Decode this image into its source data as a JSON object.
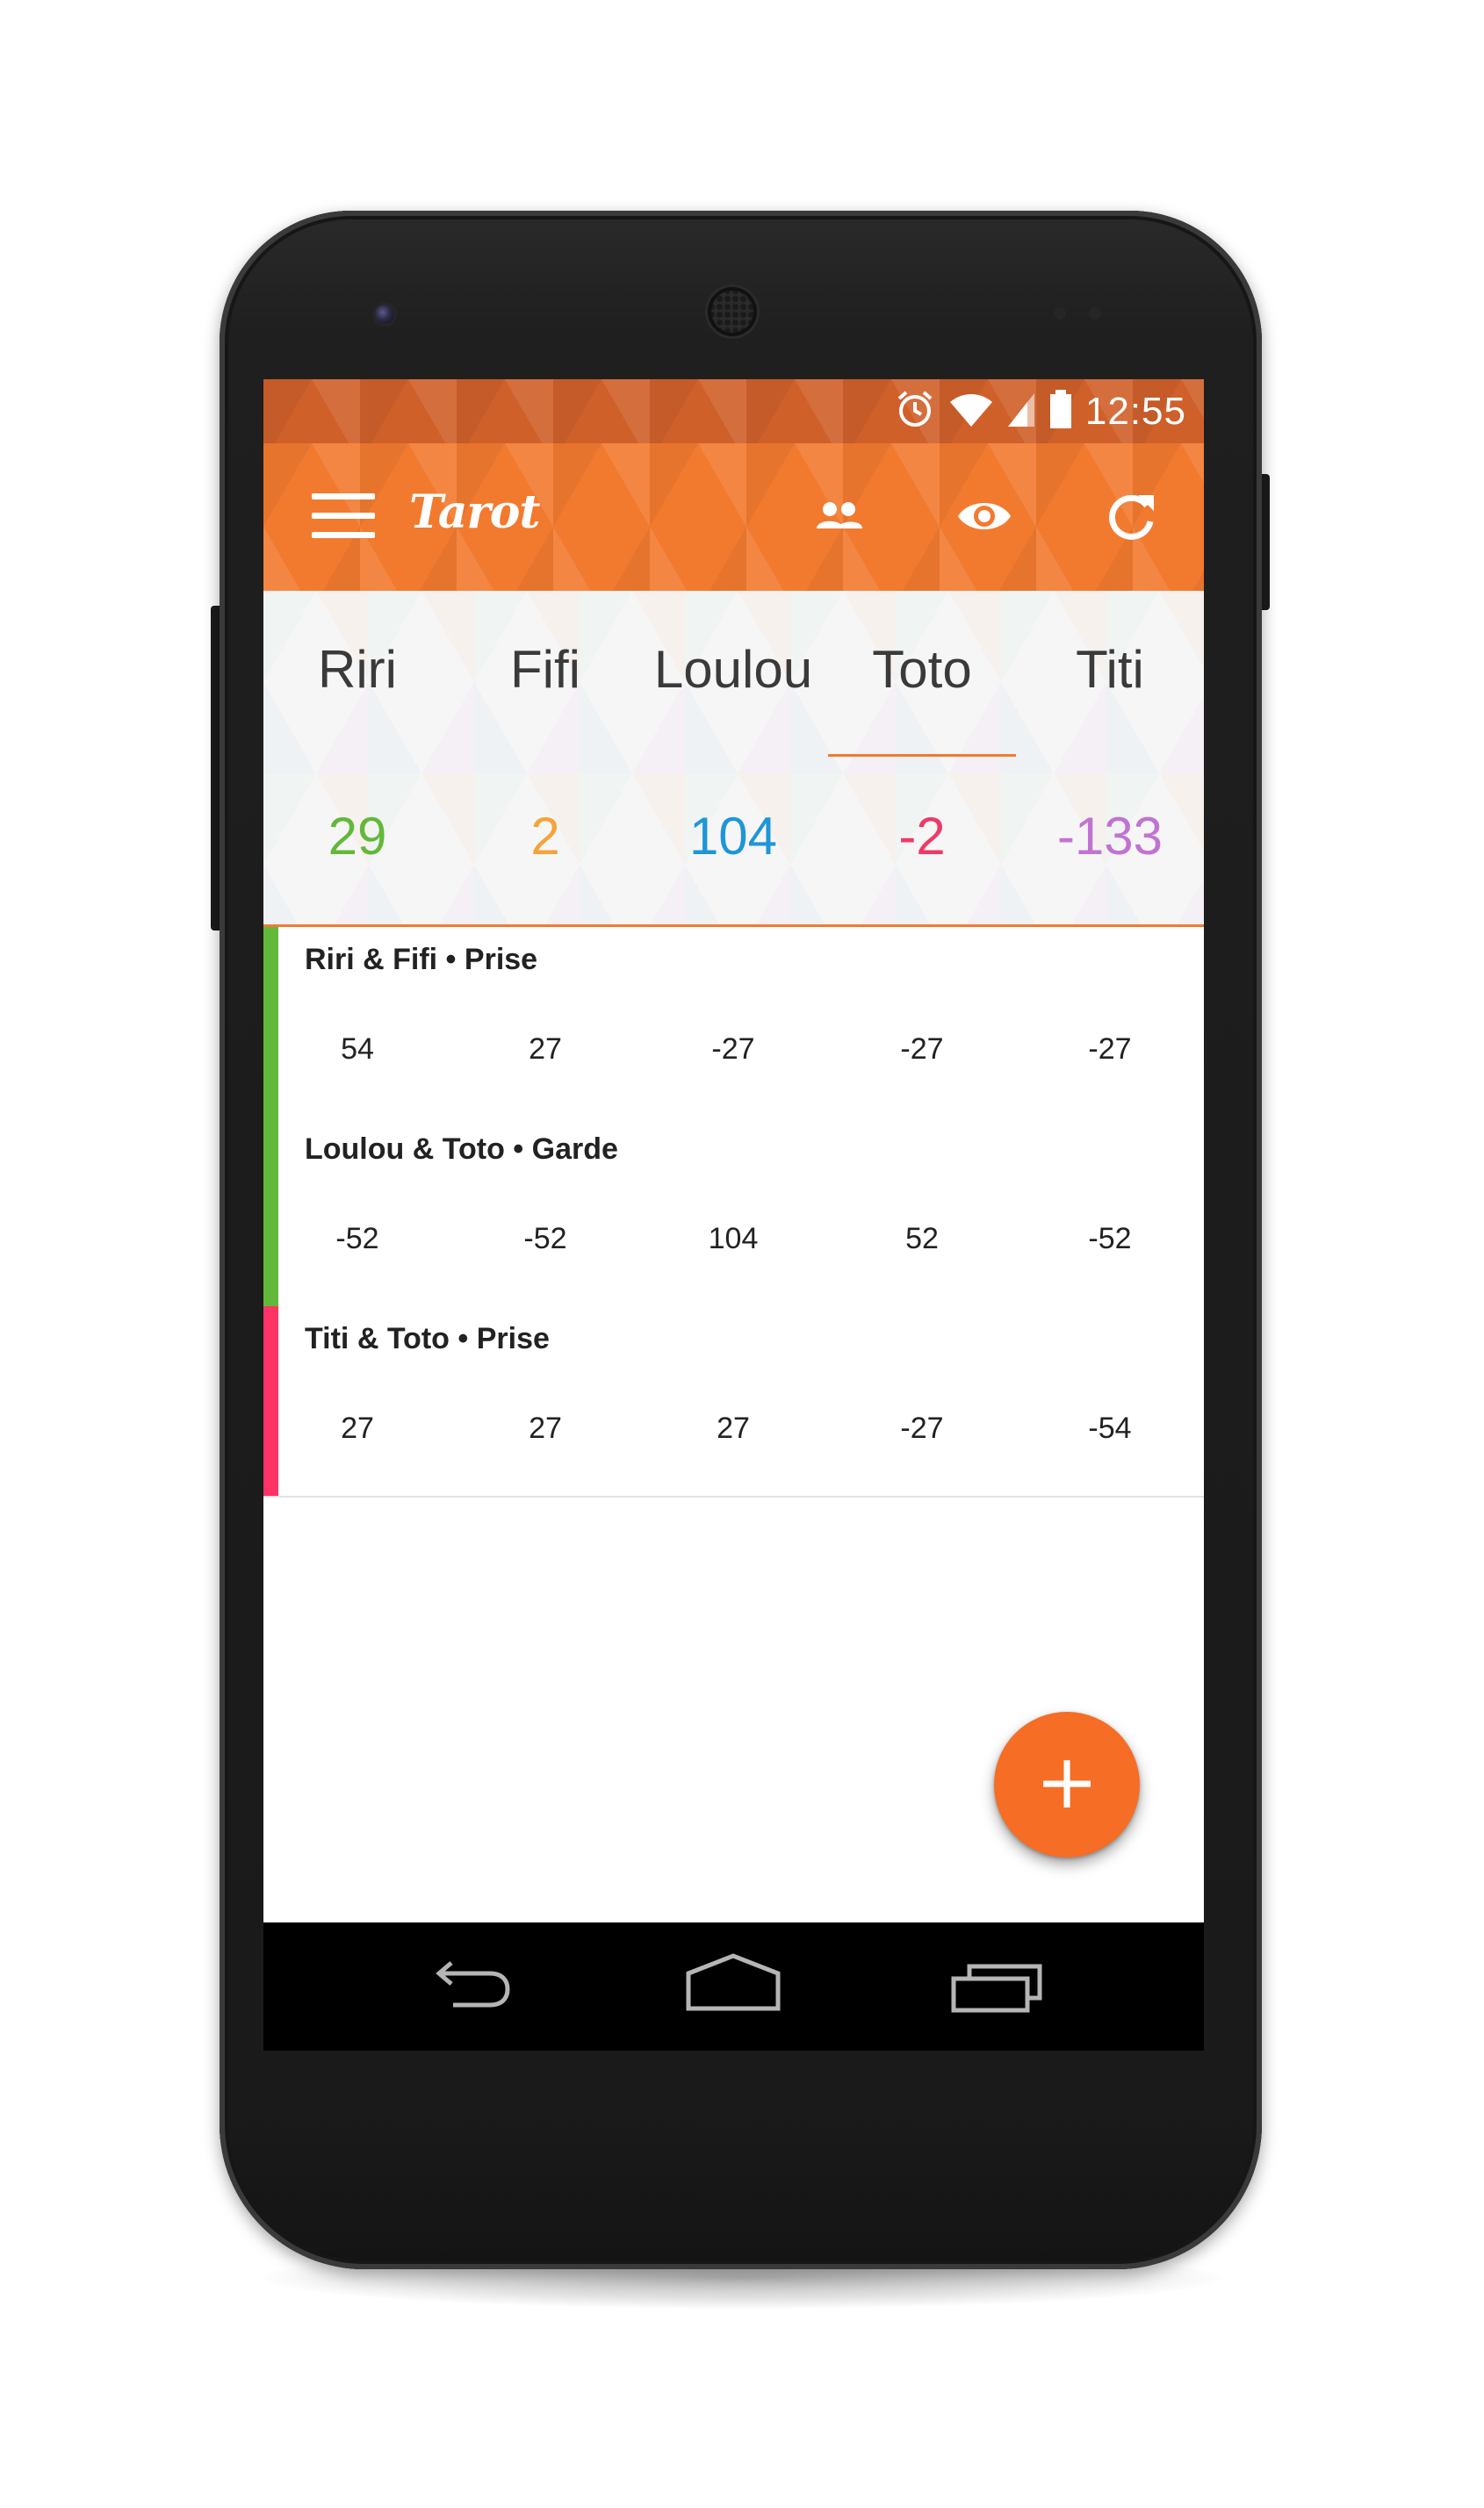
{
  "statusbar": {
    "time": "12:55",
    "icons": [
      "alarm-icon",
      "wifi-icon",
      "signal-icon",
      "battery-icon"
    ]
  },
  "toolbar": {
    "title": "Tarot",
    "icons": [
      "menu-icon",
      "players-icon",
      "eye-icon",
      "refresh-icon"
    ]
  },
  "players": [
    {
      "name": "Riri",
      "score": "29",
      "color": "#62b83a"
    },
    {
      "name": "Fifi",
      "score": "2",
      "color": "#f5a43a"
    },
    {
      "name": "Loulou",
      "score": "104",
      "color": "#1e96d8"
    },
    {
      "name": "Toto",
      "score": "-2",
      "color": "#ee3a67"
    },
    {
      "name": "Titi",
      "score": "-133",
      "color": "#c173d2"
    }
  ],
  "selected_player": "Toto",
  "rounds": [
    {
      "title": "Riri & Fifi • Prise",
      "bar_color": "#62b83a",
      "values": [
        "54",
        "27",
        "-27",
        "-27",
        "-27"
      ]
    },
    {
      "title": "Loulou & Toto • Garde",
      "bar_color": "#62b83a",
      "values": [
        "-52",
        "-52",
        "104",
        "52",
        "-52"
      ]
    },
    {
      "title": "Titi & Toto • Prise",
      "bar_color": "#ff3366",
      "values": [
        "27",
        "27",
        "27",
        "-27",
        "-54"
      ]
    }
  ],
  "fab": {
    "label": "+",
    "color": "#f66d25"
  },
  "navbar": {
    "icons": [
      "back-icon",
      "home-icon",
      "recents-icon"
    ]
  },
  "colors": {
    "accent": "#f27a2f",
    "status_bar": "#d0602a"
  }
}
